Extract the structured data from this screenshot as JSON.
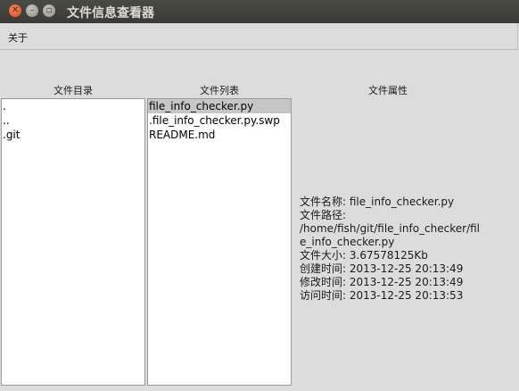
{
  "window": {
    "title": "文件信息查看器",
    "close_glyph": "✕",
    "minimize_glyph": "–",
    "maximize_glyph": "▫"
  },
  "menubar": {
    "items": [
      {
        "label": "关于"
      }
    ]
  },
  "columns": {
    "directory_label": "文件目录",
    "files_label": "文件列表",
    "properties_label": "文件属性"
  },
  "directory_list": [
    ".",
    "..",
    ".git"
  ],
  "file_list": [
    "file_info_checker.py",
    ".file_info_checker.py.swp",
    "README.md"
  ],
  "selected_file": "file_info_checker.py",
  "properties": {
    "name_label": "文件名称:",
    "name_value": "file_info_checker.py",
    "path_label": "文件路径:",
    "path_line1": "/home/fish/git/file_info_checker/fil",
    "path_line2": "e_info_checker.py",
    "size_label": "文件大小:",
    "size_value": "3.67578125Kb",
    "created_label": "创建时间:",
    "created_value": "2013-12-25 20:13:49",
    "modified_label": "修改时间:",
    "modified_value": "2013-12-25 20:13:49",
    "accessed_label": "访问时间:",
    "accessed_value": "2013-12-25 20:13:53"
  }
}
